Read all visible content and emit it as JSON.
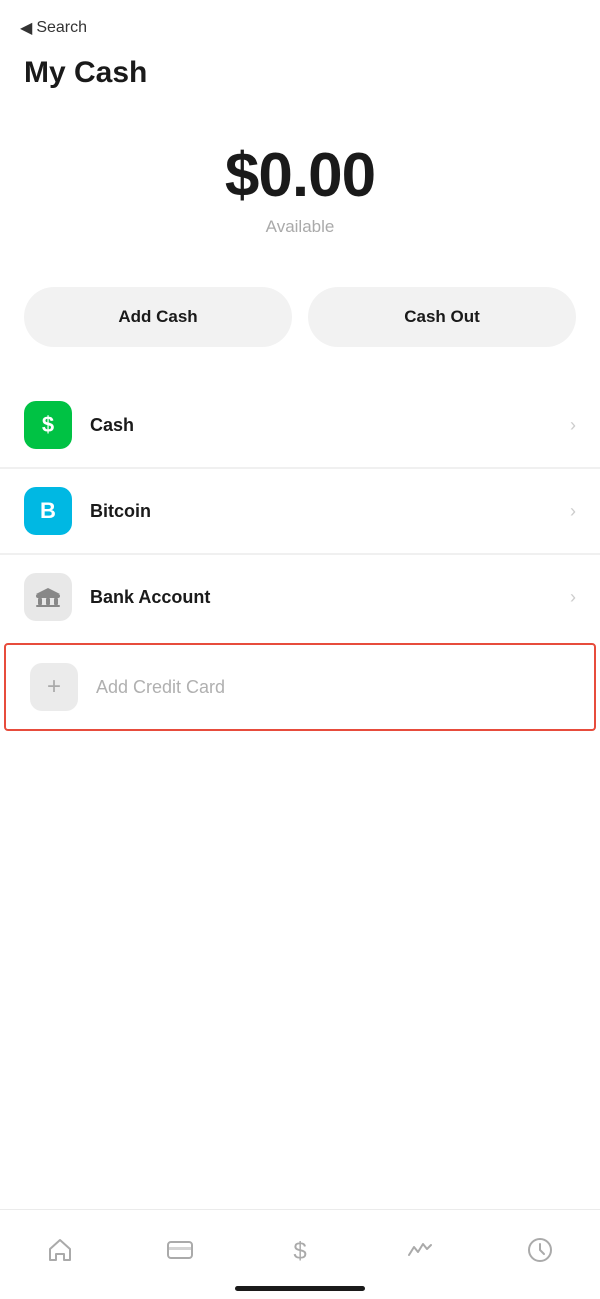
{
  "nav": {
    "back_label": "Search",
    "back_arrow": "◀"
  },
  "page": {
    "title": "My Cash"
  },
  "balance": {
    "amount": "$0.00",
    "label": "Available"
  },
  "actions": {
    "add_cash": "Add Cash",
    "cash_out": "Cash Out"
  },
  "menu_items": [
    {
      "id": "cash",
      "label": "Cash",
      "icon_type": "cash",
      "icon_text": "$",
      "has_chevron": true
    },
    {
      "id": "bitcoin",
      "label": "Bitcoin",
      "icon_type": "bitcoin",
      "icon_text": "B",
      "has_chevron": true
    },
    {
      "id": "bank",
      "label": "Bank Account",
      "icon_type": "bank",
      "icon_text": "bank",
      "has_chevron": true
    }
  ],
  "add_credit_card": {
    "label": "Add Credit Card",
    "icon_text": "+"
  },
  "bottom_nav": [
    {
      "id": "home",
      "icon": "home",
      "label": ""
    },
    {
      "id": "card",
      "icon": "card",
      "label": ""
    },
    {
      "id": "dollar",
      "icon": "dollar",
      "label": ""
    },
    {
      "id": "activity",
      "icon": "activity",
      "label": ""
    },
    {
      "id": "clock",
      "icon": "clock",
      "label": ""
    }
  ],
  "colors": {
    "green": "#00c244",
    "blue": "#00b8e3",
    "red": "#e74c3c",
    "gray_bg": "#f2f2f2",
    "icon_gray": "#e8e8e8"
  }
}
